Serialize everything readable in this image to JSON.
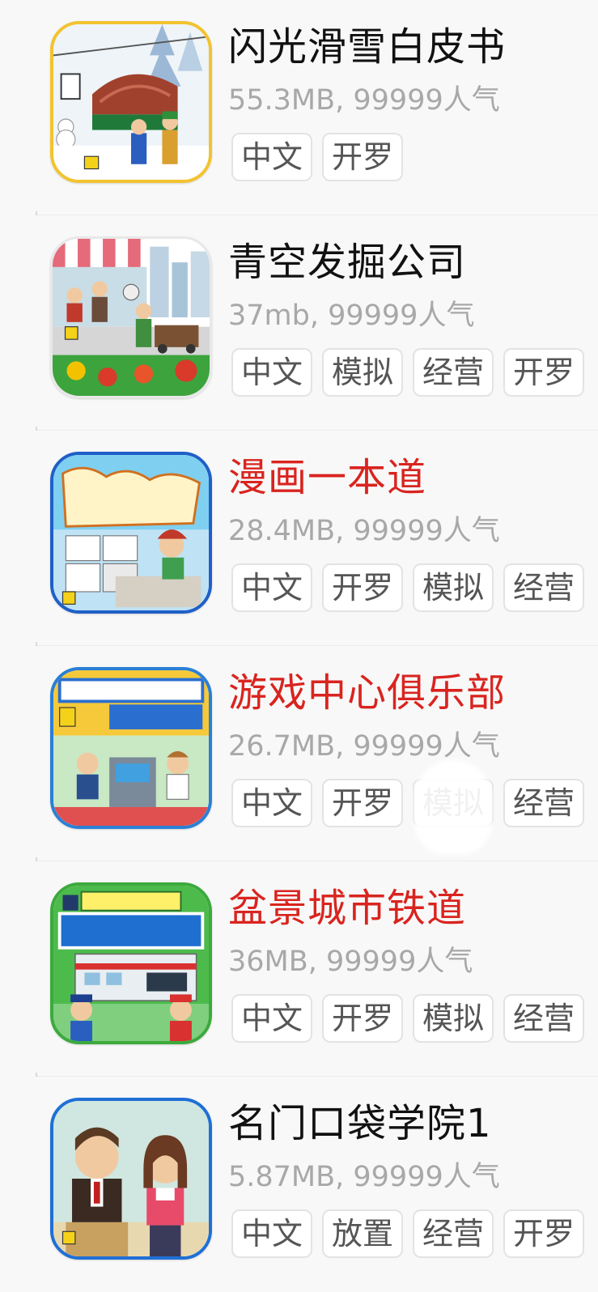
{
  "apps": [
    {
      "title": "闪光滑雪白皮书",
      "highlight": false,
      "meta": "55.3MB, 99999人气",
      "tags": [
        "中文",
        "开罗"
      ],
      "icon": "ski-resort-icon",
      "icon_border": "#f2c330"
    },
    {
      "title": "青空发掘公司",
      "highlight": false,
      "meta": "37mb, 99999人气",
      "tags": [
        "中文",
        "模拟",
        "经营",
        "开罗"
      ],
      "icon": "street-market-icon",
      "icon_border": "#e8e8e8"
    },
    {
      "title": "漫画一本道",
      "highlight": true,
      "meta": "28.4MB, 99999人气",
      "tags": [
        "中文",
        "开罗",
        "模拟",
        "经营"
      ],
      "icon": "manga-artist-icon",
      "icon_border": "#1f5fc8"
    },
    {
      "title": "游戏中心俱乐部",
      "highlight": true,
      "meta": "26.7MB, 99999人气",
      "tags": [
        "中文",
        "开罗",
        "模拟",
        "经营"
      ],
      "icon": "arcade-center-icon",
      "icon_border": "#2a7fd6"
    },
    {
      "title": "盆景城市铁道",
      "highlight": true,
      "meta": "36MB, 99999人气",
      "tags": [
        "中文",
        "开罗",
        "模拟",
        "经营"
      ],
      "icon": "city-railway-icon",
      "icon_border": "#3caa3c"
    },
    {
      "title": "名门口袋学院1",
      "highlight": false,
      "meta": "5.87MB, 99999人气",
      "tags": [
        "中文",
        "放置",
        "经营",
        "开罗"
      ],
      "icon": "pocket-academy-icon",
      "icon_border": "#1f6fd6"
    }
  ],
  "colors": {
    "title": "#111111",
    "title_highlight": "#d9241f",
    "meta": "#a8a8a8",
    "tag_text": "#555555",
    "tag_border": "#e3e3e3",
    "background": "#f8f8f8"
  }
}
